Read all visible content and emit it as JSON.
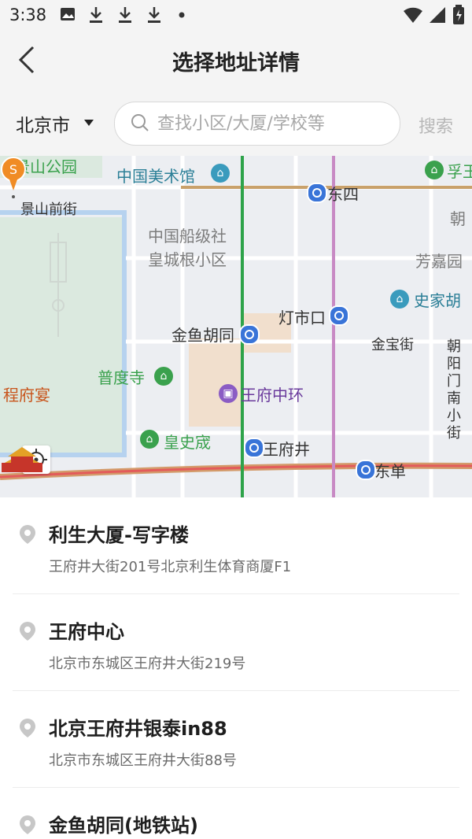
{
  "status_bar": {
    "time": "3:38"
  },
  "header": {
    "title": "选择地址详情"
  },
  "search": {
    "city": "北京市",
    "placeholder": "查找小区/大厦/学校等",
    "button": "搜索"
  },
  "map": {
    "labels": {
      "jingshan_park": "景山公园",
      "art_museum": "中国美术馆",
      "dongsi": "东四",
      "fuzi": "孚王",
      "jingshan_front": "景山前街",
      "chao": "朝",
      "ship_community": "中国船级社",
      "huangcheng": "皇城根小区",
      "fangjia": "芳嘉园",
      "shijia": "史家胡",
      "dengshikou": "灯市口",
      "jinyu": "金鱼胡同",
      "jinbao": "金宝街",
      "chaoyangmen": "朝阳门南小街",
      "pudu": "普度寺",
      "chengfu": "程府宴",
      "wangfu_zhonghuan": "王府中环",
      "huangshi": "皇史宬",
      "wangfujing": "王府井",
      "dongdan": "东单",
      "pin_badge": "S"
    }
  },
  "results": [
    {
      "name": "利生大厦-写字楼",
      "address": "王府井大街201号北京利生体育商厦F1"
    },
    {
      "name": "王府中心",
      "address": "北京市东城区王府井大街219号"
    },
    {
      "name": "北京王府井银泰in88",
      "address": "北京市东城区王府井大街88号"
    },
    {
      "name": "金鱼胡同(地铁站)",
      "address": ""
    }
  ]
}
